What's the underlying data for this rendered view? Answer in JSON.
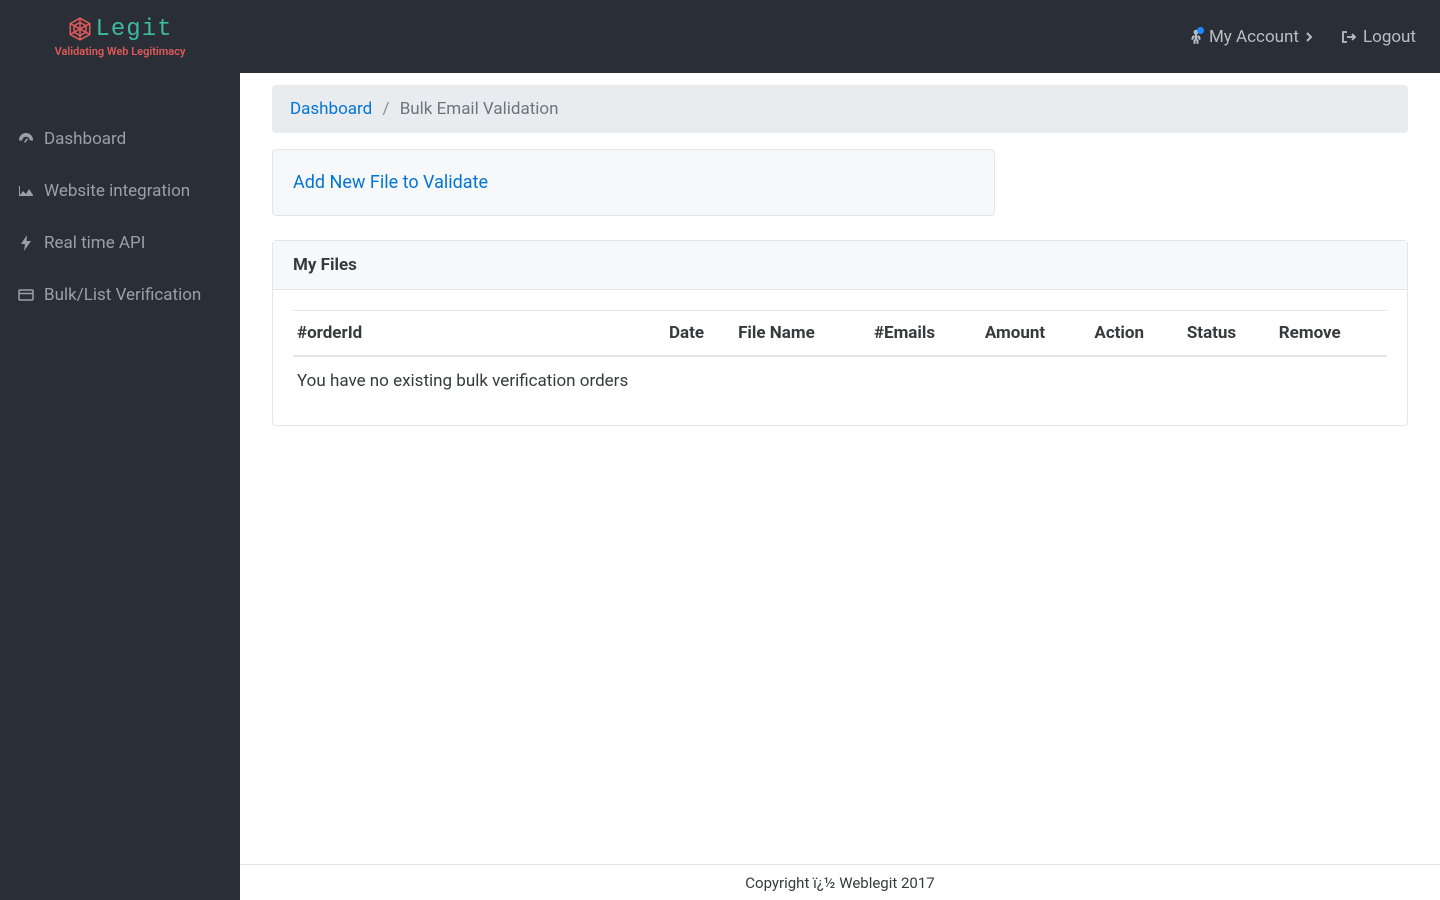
{
  "brand": {
    "name": "Legit",
    "tagline": "Validating Web Legitimacy"
  },
  "topnav": {
    "account_label": "My Account",
    "logout_label": "Logout"
  },
  "sidebar": {
    "items": [
      {
        "label": "Dashboard",
        "icon": "gauge-icon"
      },
      {
        "label": "Website integration",
        "icon": "area-chart-icon"
      },
      {
        "label": "Real time API",
        "icon": "bolt-icon"
      },
      {
        "label": "Bulk/List Verification",
        "icon": "card-icon"
      }
    ]
  },
  "breadcrumb": {
    "root": "Dashboard",
    "sep": "/",
    "current": "Bulk Email Validation"
  },
  "add_file": {
    "link_label": "Add New File to Validate"
  },
  "files_panel": {
    "title": "My Files",
    "columns": [
      "#orderId",
      "Date",
      "File Name",
      "#Emails",
      "Amount",
      "Action",
      "Status",
      "Remove"
    ],
    "empty_message": "You have no existing bulk verification orders"
  },
  "footer": {
    "text": "Copyright ï¿½ Weblegit 2017"
  }
}
